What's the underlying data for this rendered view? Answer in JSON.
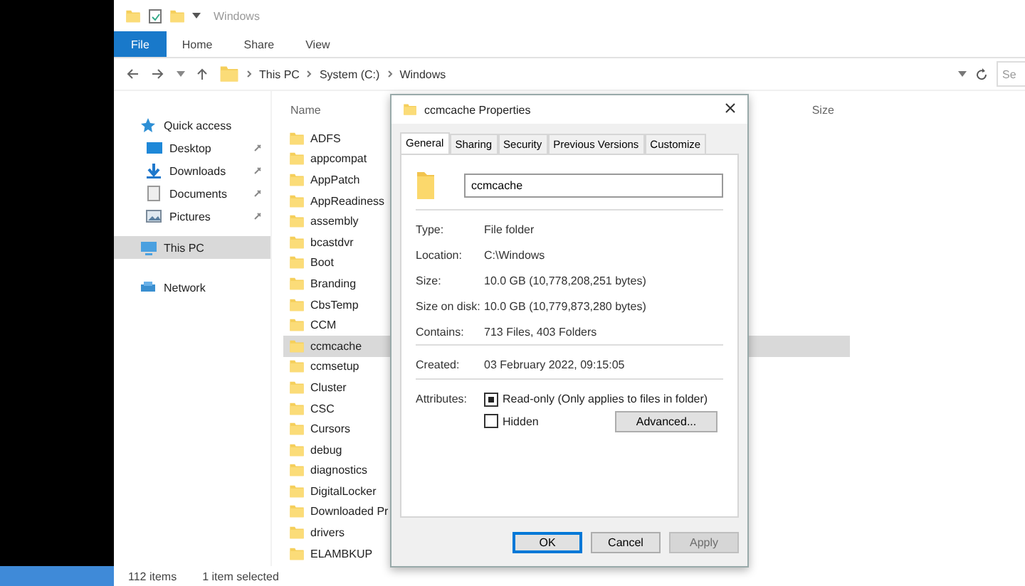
{
  "window": {
    "title": "Windows"
  },
  "ribbon_tabs": [
    {
      "label": "File",
      "selected": true
    },
    {
      "label": "Home",
      "selected": false
    },
    {
      "label": "Share",
      "selected": false
    },
    {
      "label": "View",
      "selected": false
    }
  ],
  "address": {
    "path": [
      "This PC",
      "System (C:)",
      "Windows"
    ],
    "search_placeholder": "Se"
  },
  "navigation": [
    {
      "label": "Quick access",
      "kind": "star",
      "pinned": false,
      "selected": false
    },
    {
      "label": "Desktop",
      "kind": "desktop",
      "pinned": true,
      "selected": false
    },
    {
      "label": "Downloads",
      "kind": "download",
      "pinned": true,
      "selected": false
    },
    {
      "label": "Documents",
      "kind": "document",
      "pinned": true,
      "selected": false
    },
    {
      "label": "Pictures",
      "kind": "picture",
      "pinned": true,
      "selected": false
    },
    {
      "label": "This PC",
      "kind": "computer",
      "pinned": false,
      "selected": true
    },
    {
      "label": "Network",
      "kind": "network",
      "pinned": false,
      "selected": false
    }
  ],
  "file_list": {
    "columns": [
      "Name",
      "Size"
    ],
    "rows": [
      {
        "name": "ADFS",
        "selected": false
      },
      {
        "name": "appcompat",
        "selected": false
      },
      {
        "name": "AppPatch",
        "selected": false
      },
      {
        "name": "AppReadiness",
        "selected": false
      },
      {
        "name": "assembly",
        "selected": false
      },
      {
        "name": "bcastdvr",
        "selected": false
      },
      {
        "name": "Boot",
        "selected": false
      },
      {
        "name": "Branding",
        "selected": false
      },
      {
        "name": "CbsTemp",
        "selected": false
      },
      {
        "name": "CCM",
        "selected": false
      },
      {
        "name": "ccmcache",
        "selected": true
      },
      {
        "name": "ccmsetup",
        "selected": false
      },
      {
        "name": "Cluster",
        "selected": false
      },
      {
        "name": "CSC",
        "selected": false
      },
      {
        "name": "Cursors",
        "selected": false
      },
      {
        "name": "debug",
        "selected": false
      },
      {
        "name": "diagnostics",
        "selected": false
      },
      {
        "name": "DigitalLocker",
        "selected": false
      },
      {
        "name": "Downloaded Pr",
        "selected": false
      },
      {
        "name": "drivers",
        "selected": false
      },
      {
        "name": "ELAMBKUP",
        "selected": false
      }
    ]
  },
  "status_bar": {
    "item_count": "112 items",
    "selection": "1 item selected"
  },
  "dialog": {
    "title": "ccmcache Properties",
    "tabs": [
      {
        "label": "General",
        "selected": true
      },
      {
        "label": "Sharing",
        "selected": false
      },
      {
        "label": "Security",
        "selected": false
      },
      {
        "label": "Previous Versions",
        "selected": false
      },
      {
        "label": "Customize",
        "selected": false
      }
    ],
    "name_value": "ccmcache",
    "property_groups": [
      [
        {
          "label": "Type:",
          "value": "File folder"
        },
        {
          "label": "Location:",
          "value": "C:\\Windows"
        },
        {
          "label": "Size:",
          "value": "10.0 GB (10,778,208,251 bytes)"
        },
        {
          "label": "Size on disk:",
          "value": "10.0 GB (10,779,873,280 bytes)"
        },
        {
          "label": "Contains:",
          "value": "713 Files, 403 Folders"
        }
      ],
      [
        {
          "label": "Created:",
          "value": "03 February 2022, 09:15:05"
        }
      ]
    ],
    "attributes_label": "Attributes:",
    "attributes": [
      {
        "label": "Read-only (Only applies to files in folder)",
        "checked": true
      },
      {
        "label": "Hidden",
        "checked": false
      }
    ],
    "advanced_button": "Advanced...",
    "buttons": [
      {
        "label": "OK",
        "default": true,
        "disabled": false
      },
      {
        "label": "Cancel",
        "default": false,
        "disabled": false
      },
      {
        "label": "Apply",
        "default": false,
        "disabled": true
      }
    ]
  }
}
